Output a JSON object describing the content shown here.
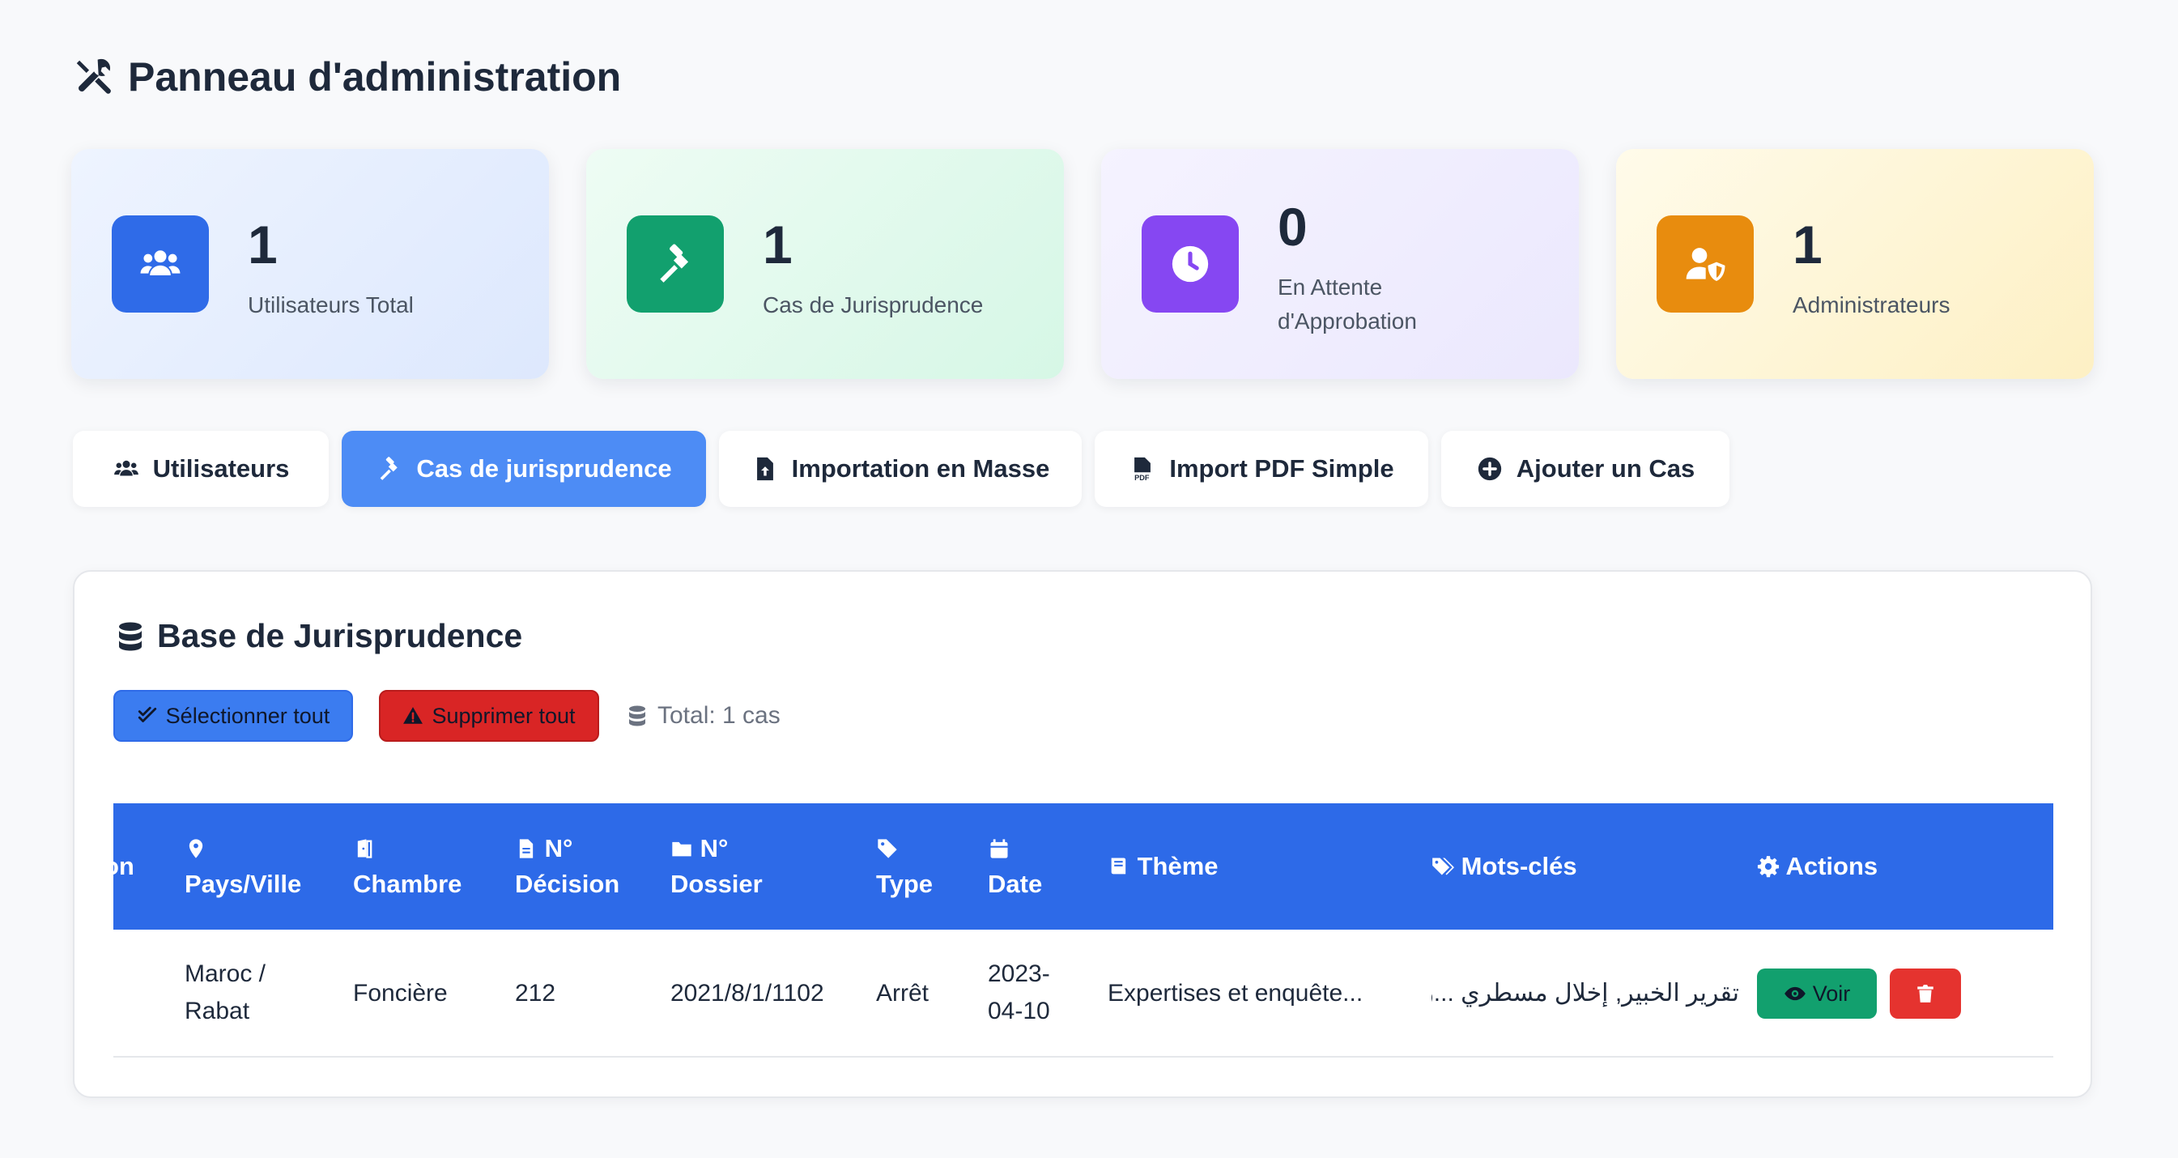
{
  "header": {
    "title": "Panneau d'administration",
    "icon": "tools-icon"
  },
  "stats": [
    {
      "value": "1",
      "label": "Utilisateurs Total",
      "icon": "users-icon",
      "color": "#2f6be8"
    },
    {
      "value": "1",
      "label": "Cas de Jurisprudence",
      "icon": "gavel-icon",
      "color": "#12a06e"
    },
    {
      "value": "0",
      "label": "En Attente d'Approbation",
      "icon": "clock-icon",
      "color": "#8647f2"
    },
    {
      "value": "1",
      "label": "Administrateurs",
      "icon": "user-shield-icon",
      "color": "#e88c0e"
    }
  ],
  "tabs": [
    {
      "label": "Utilisateurs",
      "icon": "users-icon"
    },
    {
      "label": "Cas de jurisprudence",
      "icon": "gavel-icon",
      "active": true
    },
    {
      "label": "Importation en Masse",
      "icon": "file-upload-icon"
    },
    {
      "label": "Import PDF Simple",
      "icon": "file-pdf-icon"
    },
    {
      "label": "Ajouter un Cas",
      "icon": "plus-circle-icon"
    }
  ],
  "panel": {
    "title": "Base de Jurisprudence",
    "select_all": "Sélectionner tout",
    "delete_all": "Supprimer tout",
    "total": "Total: 1 cas"
  },
  "table": {
    "columns": [
      {
        "key": "partial",
        "label": "on"
      },
      {
        "key": "country",
        "label": "Pays/Ville",
        "icon": "map-marker-icon"
      },
      {
        "key": "chamber",
        "label": "Chambre",
        "icon": "door-icon"
      },
      {
        "key": "decision",
        "label_line1": "N°",
        "label_line2": "Décision",
        "icon": "file-icon"
      },
      {
        "key": "folder",
        "label_line1": "N°",
        "label_line2": "Dossier",
        "icon": "folder-icon"
      },
      {
        "key": "type",
        "label": "Type",
        "icon": "tag-icon"
      },
      {
        "key": "date",
        "label": "Date",
        "icon": "calendar-icon"
      },
      {
        "key": "theme",
        "label": "Thème",
        "icon": "book-icon"
      },
      {
        "key": "keywords",
        "label": "Mots-clés",
        "icon": "tags-icon"
      },
      {
        "key": "actions",
        "label": "Actions",
        "icon": "cog-icon"
      }
    ],
    "rows": [
      {
        "country_line1": "Maroc /",
        "country_line2": "Rabat",
        "chamber": "Foncière",
        "decision": "212",
        "folder": "2021/8/1/1102",
        "type": "Arrêt",
        "date_line1": "2023-",
        "date_line2": "04-10",
        "theme": "Expertises et enquête...",
        "keywords": "تقرير الخبير, إخلال مسطري ...ر",
        "view_label": "Voir"
      }
    ]
  }
}
